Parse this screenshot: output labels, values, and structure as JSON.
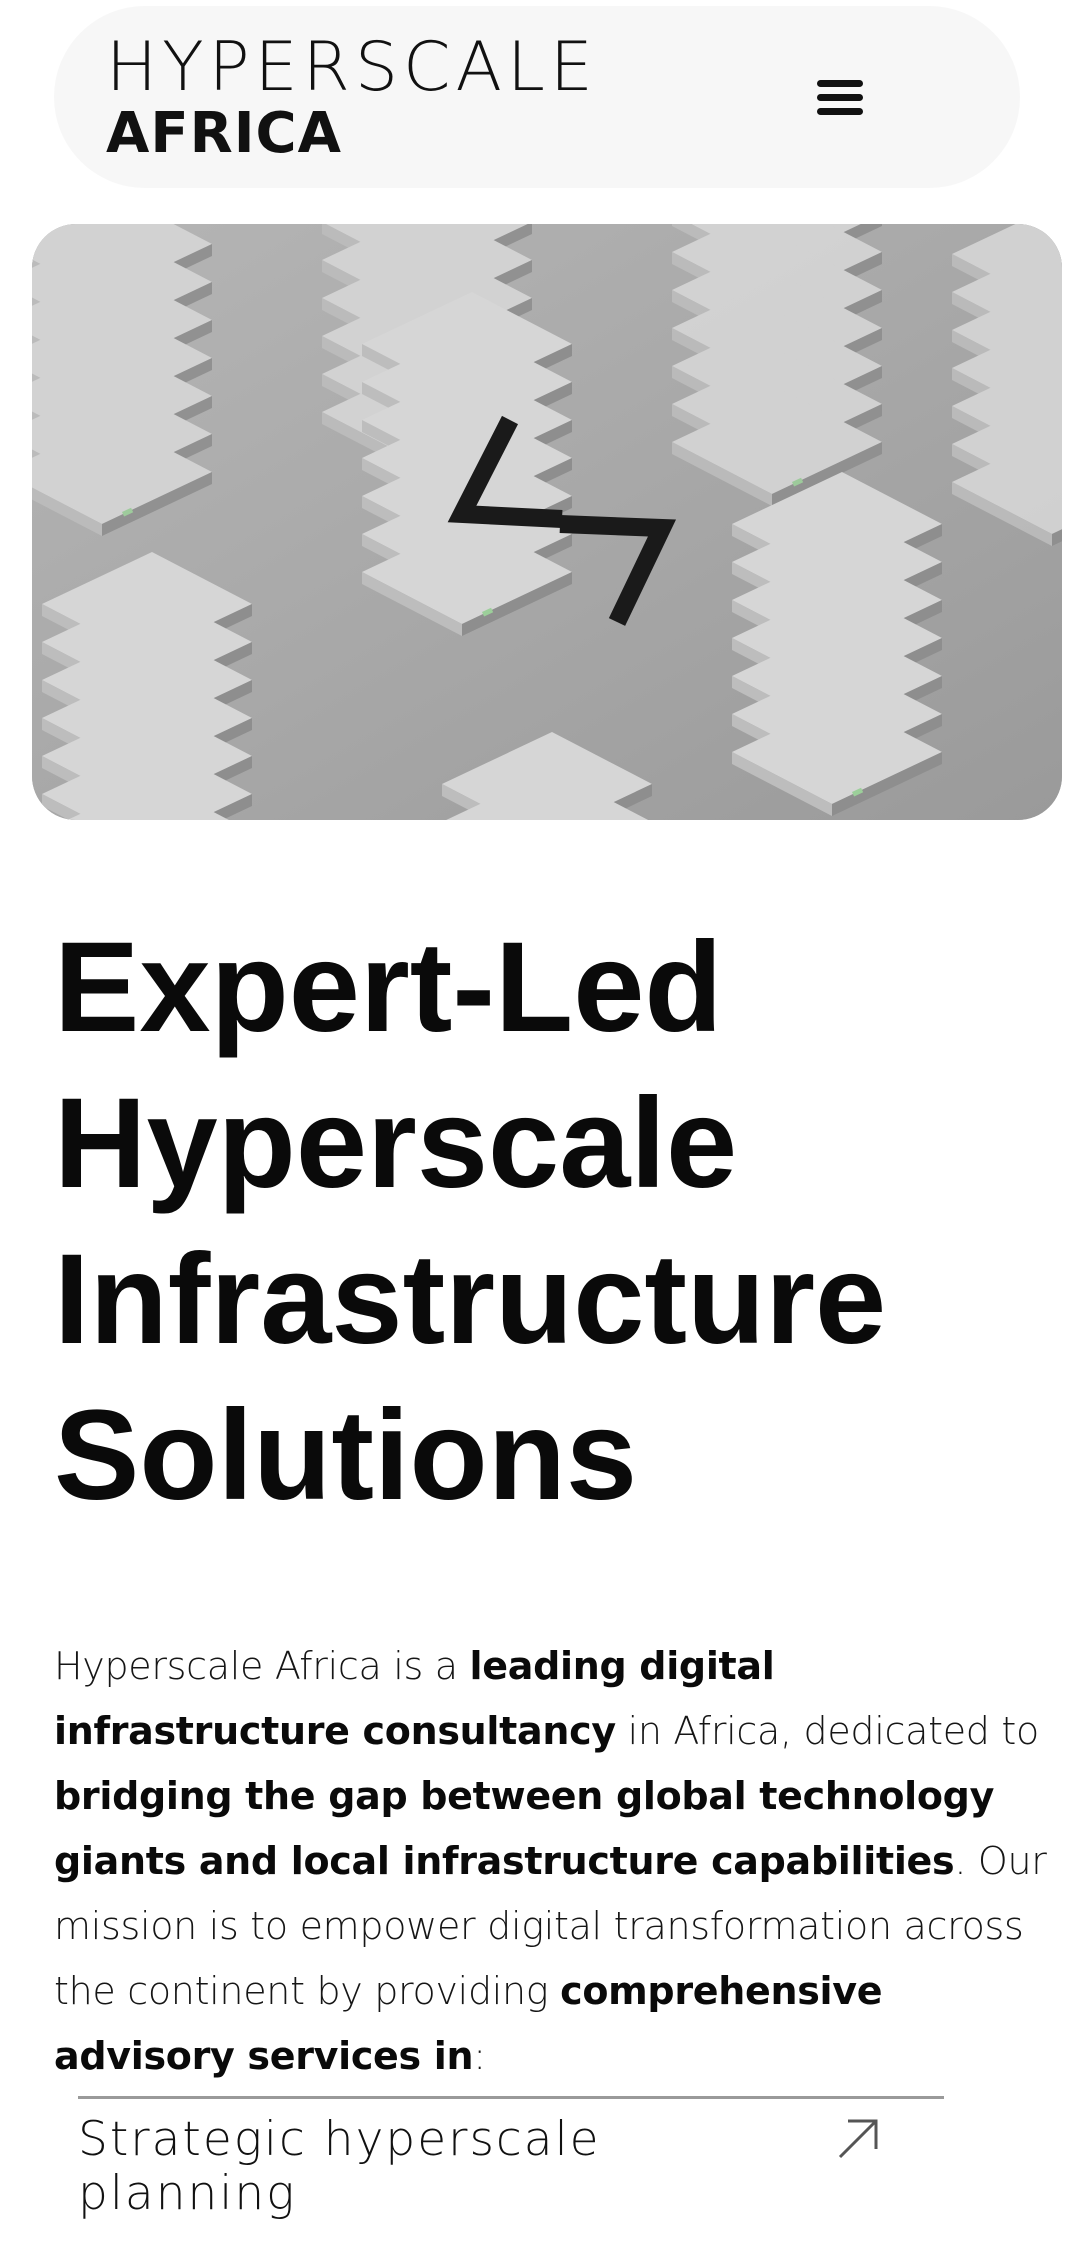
{
  "header": {
    "logo_line1": "HYPERSCALE",
    "logo_line2": "AFRICA",
    "menu_icon": "hamburger-menu-icon"
  },
  "hero": {
    "description_icon": "server-racks-image",
    "mark_icon": "hyperscale-monogram-mark"
  },
  "headline": {
    "line1": "Expert-Led",
    "line2": "Hyperscale",
    "line3": "Infrastructure",
    "line4": "Solutions"
  },
  "intro": {
    "p1": "Hyperscale Africa is a ",
    "b1": "leading digital infrastructure consultancy",
    "p2": " in Africa, dedicated to ",
    "b2": "bridging the gap between global technology giants and local infrastructure capabilities",
    "p3": ". Our mission is to empower digital transformation across the continent by providing ",
    "b3": "comprehensive advisory services in",
    "p4": ":"
  },
  "services": {
    "items": [
      {
        "label": "Strategic hyperscale planning",
        "icon": "arrow-up-right-icon"
      }
    ]
  },
  "colors": {
    "header_bg": "#f7f7f7",
    "text": "#0a0a0a",
    "divider": "#9a9a9a"
  }
}
